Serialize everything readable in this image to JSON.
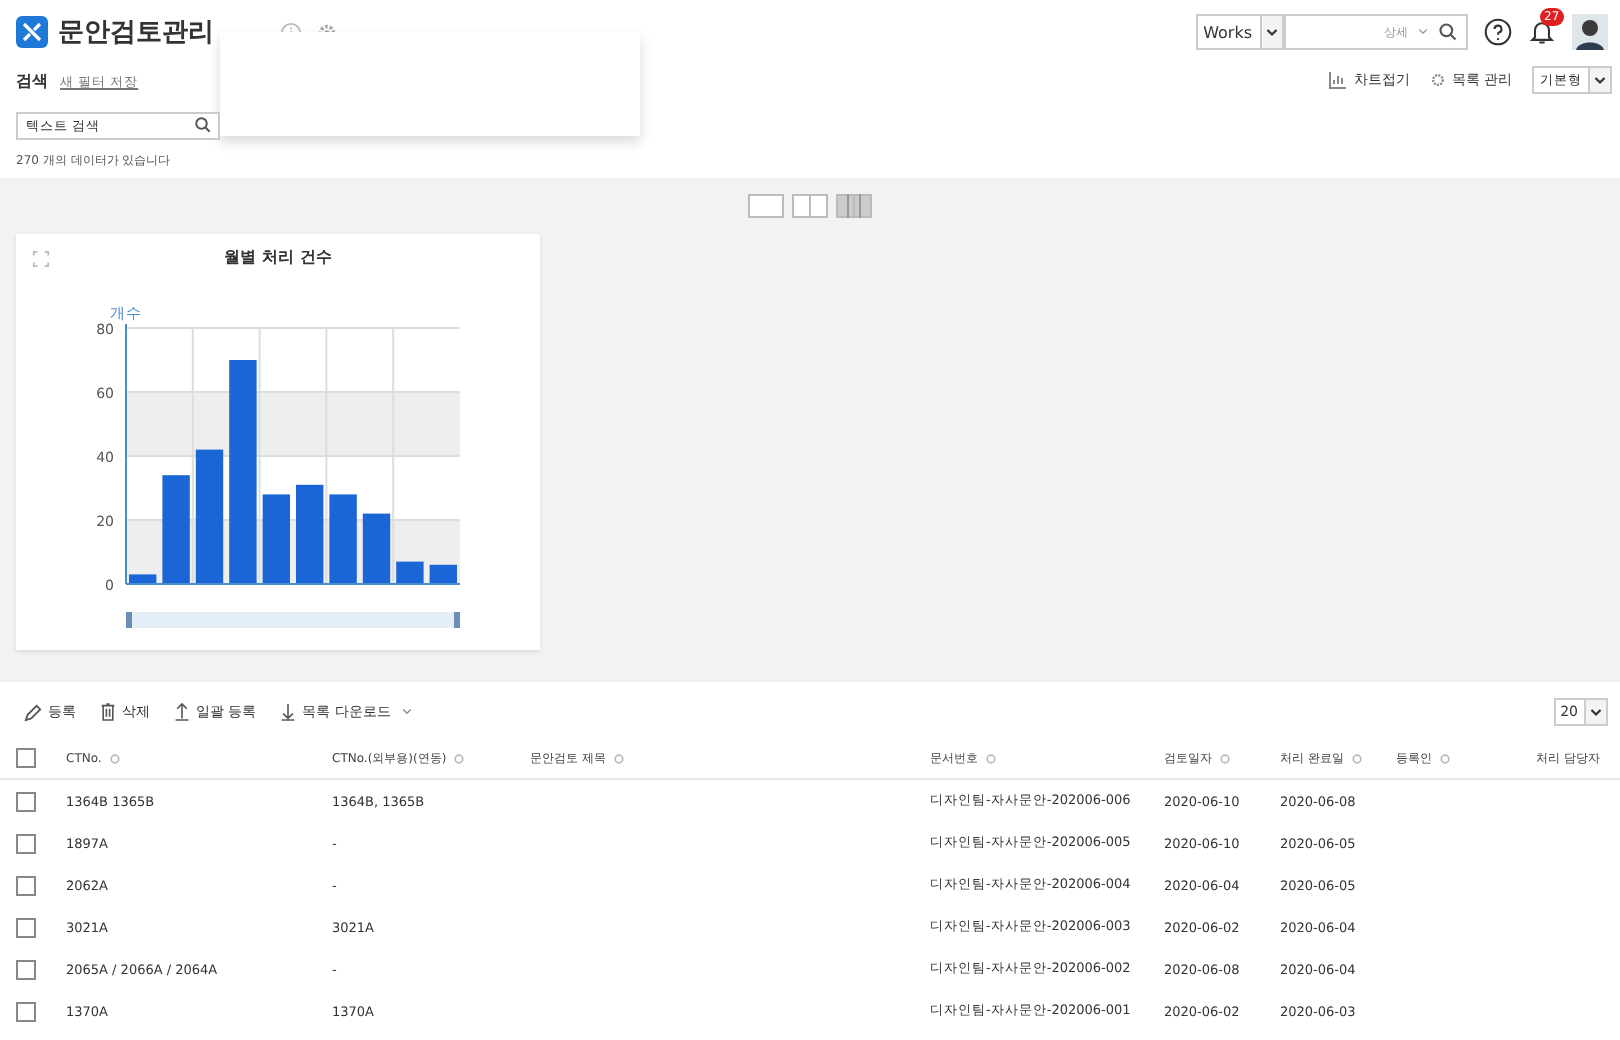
{
  "header": {
    "app_title": "문안검토관리",
    "search_scope": "Works",
    "search_detail": "상세",
    "notification_count": "27"
  },
  "filter": {
    "title": "검색",
    "save_filter_link": "새 필터 저장",
    "search_placeholder": "텍스트 검색",
    "result_count": "270 개의 데이터가 있습니다"
  },
  "view_actions": {
    "collapse_chart": "차트접기",
    "manage_list": "목록 관리",
    "layout_select": "기본형"
  },
  "layout_toggles": [
    {
      "selected": false
    },
    {
      "selected": false
    },
    {
      "selected": true
    }
  ],
  "chart": {
    "title": "월별 처리 건수",
    "chart_data": {
      "type": "bar",
      "grid": true,
      "ylabel": "개수",
      "values": [
        3,
        34,
        42,
        70,
        28,
        31,
        28,
        22,
        7,
        6
      ],
      "ylim": [
        0,
        80
      ],
      "yticks": [
        0,
        20,
        40,
        60,
        80
      ]
    }
  },
  "toolbar": {
    "buttons": [
      {
        "kind": "edit",
        "label": "등록"
      },
      {
        "kind": "delete",
        "label": "삭제"
      },
      {
        "kind": "upload",
        "label": "일괄 등록"
      },
      {
        "kind": "download",
        "label": "목록 다운로드"
      }
    ],
    "page_size": "20"
  },
  "table": {
    "columns": [
      "CTNo.",
      "CTNo.(외부용)(연동)",
      "문안검토 제목",
      "문서번호",
      "검토일자",
      "처리 완료일",
      "등록인",
      "처리 담당자"
    ],
    "all_checked": false,
    "sortable": [
      true,
      true,
      true,
      true,
      true,
      true,
      true,
      false
    ],
    "rows": [
      {
        "checked": false,
        "cells": [
          "1364B 1365B",
          "1364B, 1365B",
          "",
          "디자인팀-자사문안-202006-006",
          "2020-06-10",
          "2020-06-08",
          "",
          ""
        ]
      },
      {
        "checked": false,
        "cells": [
          "1897A",
          "-",
          "",
          "디자인팀-자사문안-202006-005",
          "2020-06-10",
          "2020-06-05",
          "",
          ""
        ]
      },
      {
        "checked": false,
        "cells": [
          "2062A",
          "-",
          "",
          "디자인팀-자사문안-202006-004",
          "2020-06-04",
          "2020-06-05",
          "",
          ""
        ]
      },
      {
        "checked": false,
        "cells": [
          "3021A",
          "3021A",
          "",
          "디자인팀-자사문안-202006-003",
          "2020-06-02",
          "2020-06-04",
          "",
          ""
        ]
      },
      {
        "checked": false,
        "cells": [
          "2065A / 2066A / 2064A",
          "-",
          "",
          "디자인팀-자사문안-202006-002",
          "2020-06-08",
          "2020-06-04",
          "",
          ""
        ]
      },
      {
        "checked": false,
        "cells": [
          "1370A",
          "1370A",
          "",
          "디자인팀-자사문안-202006-001",
          "2020-06-02",
          "2020-06-03",
          "",
          ""
        ]
      }
    ]
  }
}
